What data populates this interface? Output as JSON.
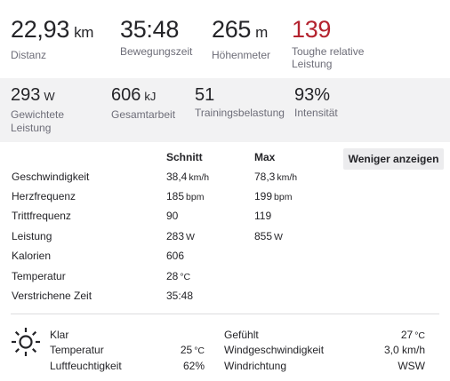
{
  "primary_stats": [
    {
      "value": "22,93",
      "unit": "km",
      "label": "Distanz"
    },
    {
      "value": "35:48",
      "unit": "",
      "label": "Bewegungszeit"
    },
    {
      "value": "265",
      "unit": "m",
      "label": "Höhenmeter"
    },
    {
      "value": "139",
      "unit": "",
      "label_line1": "Toughe relative",
      "label_line2": "Leistung"
    }
  ],
  "secondary_stats": [
    {
      "value": "293",
      "unit": "W",
      "label_line1": "Gewichtete",
      "label_line2": "Leistung"
    },
    {
      "value": "606",
      "unit": "kJ",
      "label": "Gesamtarbeit"
    },
    {
      "value": "51",
      "unit": "",
      "label": "Trainingsbelastung"
    },
    {
      "value": "93%",
      "unit": "",
      "label": "Intensität"
    }
  ],
  "table": {
    "header_avg": "Schnitt",
    "header_max": "Max",
    "less_button": "Weniger anzeigen",
    "rows": [
      {
        "label": "Geschwindigkeit",
        "avg": "38,4",
        "avg_unit": "km/h",
        "max": "78,3",
        "max_unit": "km/h"
      },
      {
        "label": "Herzfrequenz",
        "avg": "185",
        "avg_unit": "bpm",
        "max": "199",
        "max_unit": "bpm"
      },
      {
        "label": "Trittfrequenz",
        "avg": "90",
        "avg_unit": "",
        "max": "119",
        "max_unit": ""
      },
      {
        "label": "Leistung",
        "avg": "283",
        "avg_unit": "W",
        "max": "855",
        "max_unit": "W"
      },
      {
        "label": "Kalorien",
        "avg": "606",
        "avg_unit": "",
        "max": "",
        "max_unit": ""
      },
      {
        "label": "Temperatur",
        "avg": "28",
        "avg_unit": "°C",
        "max": "",
        "max_unit": ""
      },
      {
        "label": "Verstrichene Zeit",
        "avg": "35:48",
        "avg_unit": "",
        "max": "",
        "max_unit": ""
      }
    ]
  },
  "weather": {
    "icon": "sun-icon",
    "condition": "Klar",
    "temperature_label": "Temperatur",
    "temperature_value": "25",
    "temperature_unit": "°C",
    "humidity_label": "Luftfeuchtigkeit",
    "humidity_value": "62%",
    "feels_label": "Gefühlt",
    "feels_value": "27",
    "feels_unit": "°C",
    "wind_speed_label": "Windgeschwindigkeit",
    "wind_speed_value": "3,0 km/h",
    "wind_dir_label": "Windrichtung",
    "wind_dir_value": "WSW"
  },
  "colors": {
    "accent_red": "#b4232f",
    "secondary_bg": "#f2f2f3",
    "muted_text": "#6d6d78"
  }
}
